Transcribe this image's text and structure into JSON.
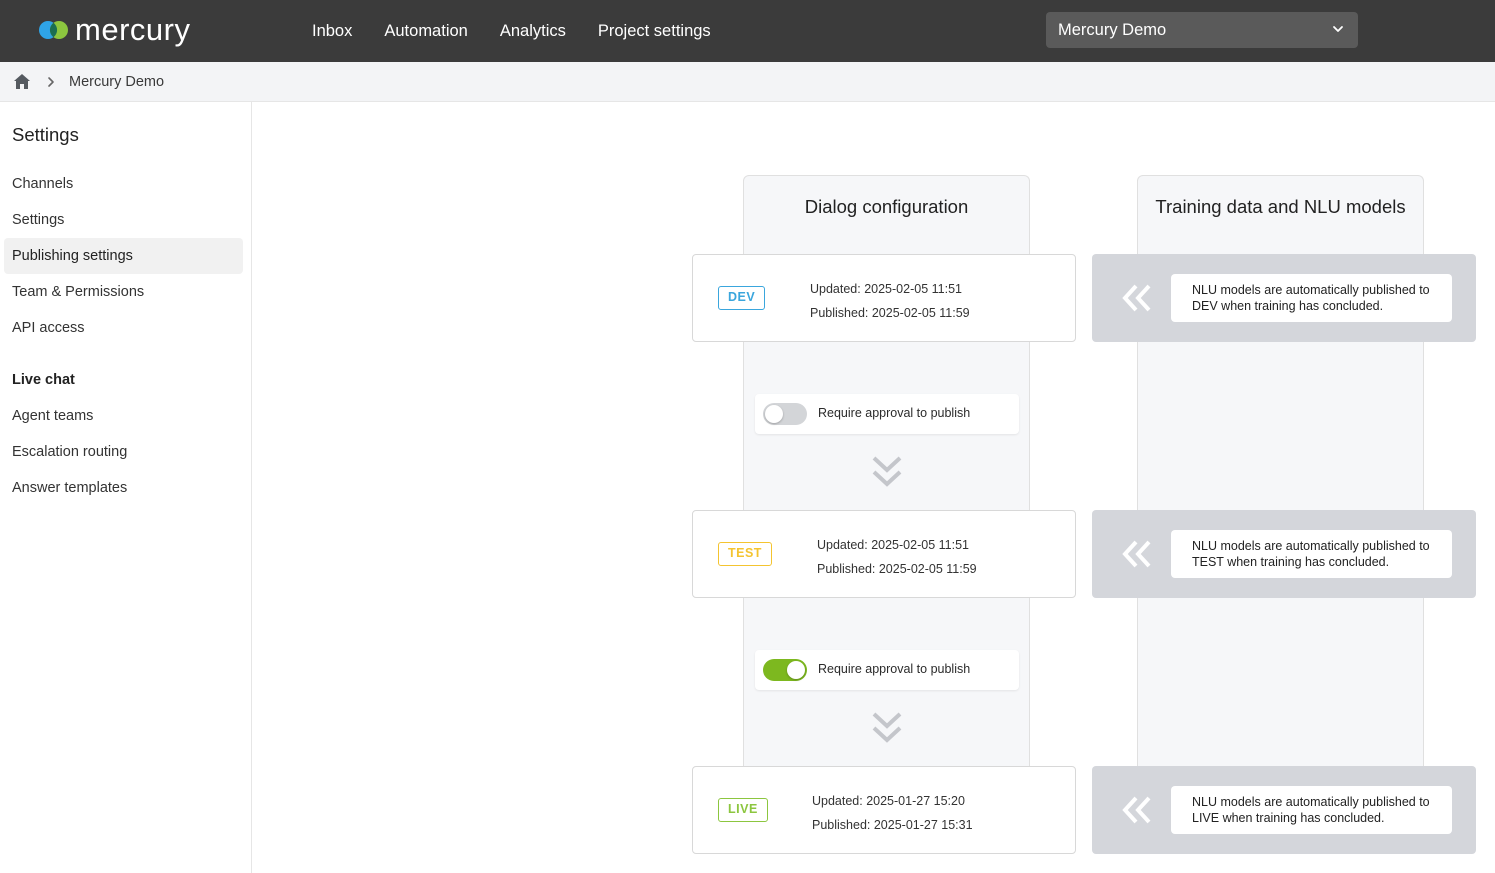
{
  "app": {
    "logo_text": "mercury",
    "nav": [
      "Inbox",
      "Automation",
      "Analytics",
      "Project settings"
    ],
    "project_selector": "Mercury Demo"
  },
  "breadcrumb": {
    "current": "Mercury Demo"
  },
  "sidebar": {
    "title": "Settings",
    "items": [
      {
        "label": "Channels",
        "active": false
      },
      {
        "label": "Settings",
        "active": false
      },
      {
        "label": "Publishing settings",
        "active": true
      },
      {
        "label": "Team & Permissions",
        "active": false
      },
      {
        "label": "API access",
        "active": false
      }
    ],
    "live_chat": {
      "heading": "Live chat",
      "items": [
        "Agent teams",
        "Escalation routing",
        "Answer templates"
      ]
    }
  },
  "columns": {
    "dialog_title": "Dialog configuration",
    "training_title": "Training data and NLU models"
  },
  "environments": [
    {
      "badge": "DEV",
      "color": "#3aa6dd",
      "updated": "Updated: 2025-02-05 11:51",
      "published": "Published: 2025-02-05 11:59",
      "nlu_line1": "NLU models are automatically published to",
      "nlu_line2": "DEV when training has concluded."
    },
    {
      "badge": "TEST",
      "color": "#f4c430",
      "updated": "Updated: 2025-02-05 11:51",
      "published": "Published: 2025-02-05 11:59",
      "nlu_line1": "NLU models are automatically published to",
      "nlu_line2": "TEST when training has concluded."
    },
    {
      "badge": "LIVE",
      "color": "#8cc63f",
      "updated": "Updated: 2025-01-27 15:20",
      "published": "Published: 2025-01-27 15:31",
      "nlu_line1": "NLU models are automatically published to",
      "nlu_line2": "LIVE when training has concluded."
    }
  ],
  "approvals": [
    {
      "label": "Require approval to publish",
      "enabled": false
    },
    {
      "label": "Require approval to publish",
      "enabled": true
    }
  ],
  "icons": {
    "home": "home-icon",
    "breadcrumb_sep": "chevron-right-icon",
    "dropdown": "chevron-down-icon",
    "flow_down": "double-chevron-down-icon",
    "nlu_arrow": "double-chevron-left-icon"
  },
  "colors": {
    "topbar": "#3b3b3b",
    "toggle_on": "#7db81f",
    "toggle_off": "#d3d5d8"
  }
}
